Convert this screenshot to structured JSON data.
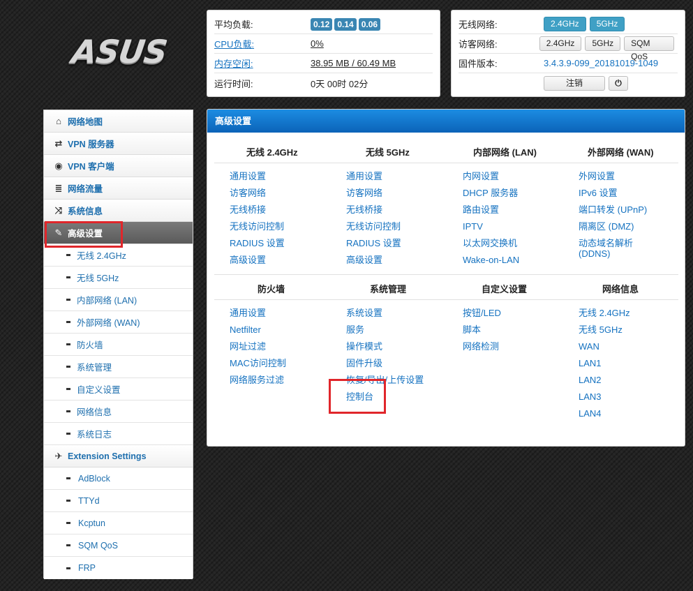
{
  "logo": {
    "text": "ASUS"
  },
  "status": {
    "load_label": "平均负载:",
    "load_values": [
      "0.12",
      "0.14",
      "0.06"
    ],
    "cpu_label": "CPU负载:",
    "cpu_value": "0%",
    "mem_label": "内存空闲:",
    "mem_value": "38.95 MB / 60.49 MB",
    "uptime_label": "运行时间:",
    "uptime_value": "0天 00时 02分"
  },
  "wireless": {
    "wifi_label": "无线网络:",
    "wifi_buttons": [
      "2.4GHz",
      "5GHz"
    ],
    "guest_label": "访客网络:",
    "guest_buttons": [
      "2.4GHz",
      "5GHz",
      "SQM QoS"
    ],
    "firmware_label": "固件版本:",
    "firmware_value": "3.4.3.9-099_20181019-1049",
    "logout_label": "注销",
    "power_symbol": "⏻"
  },
  "sidebar": {
    "items": [
      {
        "label": "网络地图",
        "icon": "home-icon",
        "glyph": "⌂"
      },
      {
        "label": "VPN 服务器",
        "icon": "retweet-icon",
        "glyph": "⇄"
      },
      {
        "label": "VPN 客户端",
        "icon": "globe-icon",
        "glyph": "◉"
      },
      {
        "label": "网络流量",
        "icon": "list-icon",
        "glyph": "≣"
      },
      {
        "label": "系统信息",
        "icon": "shuffle-icon",
        "glyph": "⤨"
      },
      {
        "label": "高级设置",
        "icon": "wrench-icon",
        "glyph": "✎"
      }
    ],
    "advanced_sub": [
      "无线 2.4GHz",
      "无线 5GHz",
      "内部网络 (LAN)",
      "外部网络 (WAN)",
      "防火墙",
      "系统管理",
      "自定义设置",
      "网络信息",
      "系统日志"
    ],
    "extension": {
      "label": "Extension Settings",
      "icon": "plane-icon",
      "glyph": "✈"
    },
    "extension_sub": [
      "AdBlock",
      "TTYd",
      "Kcptun",
      "SQM QoS",
      "FRP"
    ]
  },
  "main": {
    "title": "高级设置",
    "section1": {
      "headers": [
        "无线 2.4GHz",
        "无线 5GHz",
        "内部网络 (LAN)",
        "外部网络 (WAN)"
      ],
      "col1": [
        "通用设置",
        "访客网络",
        "无线桥接",
        "无线访问控制",
        "RADIUS 设置",
        "高级设置"
      ],
      "col2": [
        "通用设置",
        "访客网络",
        "无线桥接",
        "无线访问控制",
        "RADIUS 设置",
        "高级设置"
      ],
      "col3": [
        "内网设置",
        "DHCP 服务器",
        "路由设置",
        "IPTV",
        "以太网交换机",
        "Wake-on-LAN"
      ],
      "col4": [
        "外网设置",
        "IPv6 设置",
        "端口转发 (UPnP)",
        "隔离区 (DMZ)",
        "动态域名解析",
        "(DDNS)"
      ]
    },
    "section2": {
      "headers": [
        "防火墙",
        "系统管理",
        "自定义设置",
        "网络信息"
      ],
      "col1": [
        "通用设置",
        "Netfilter",
        "网址过滤",
        "MAC访问控制",
        "网络服务过滤"
      ],
      "col2": [
        "系统设置",
        "服务",
        "操作模式",
        "固件升级",
        "恢复/导出/上传设置",
        "控制台"
      ],
      "col3": [
        "按钮/LED",
        "脚本",
        "网络检测"
      ],
      "col4": [
        "无线 2.4GHz",
        "无线 5GHz",
        "WAN",
        "LAN1",
        "LAN2",
        "LAN3",
        "LAN4"
      ]
    }
  },
  "colors": {
    "accent": "#1572c0",
    "header_blue": "#0b63b8",
    "highlight": "#e0262b",
    "badge": "#3a86b3"
  }
}
